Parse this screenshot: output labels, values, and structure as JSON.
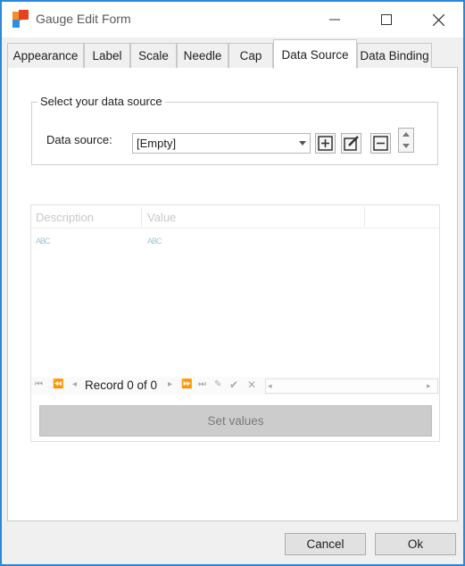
{
  "window": {
    "title": "Gauge Edit Form"
  },
  "colors": {
    "accent_border": "#2b88d8",
    "icon_red": "#e3431f",
    "icon_orange": "#f78d2c",
    "icon_blue": "#2d8fe0"
  },
  "tabs": [
    {
      "label": "Appearance",
      "active": false
    },
    {
      "label": "Label",
      "active": false
    },
    {
      "label": "Scale",
      "active": false
    },
    {
      "label": "Needle",
      "active": false
    },
    {
      "label": "Cap",
      "active": false
    },
    {
      "label": "Data Source",
      "active": true
    },
    {
      "label": "Data Binding",
      "active": false
    }
  ],
  "data_source_group": {
    "legend": "Select your data source",
    "field_label": "Data source:",
    "selected_value": "[Empty]",
    "actions": [
      "add-icon",
      "edit-icon",
      "remove-icon"
    ]
  },
  "grid": {
    "columns": [
      "Description",
      "Value"
    ],
    "cell_icon_text": "ABC",
    "navigator": {
      "record_text": "Record 0 of 0"
    },
    "set_values_label": "Set values"
  },
  "footer": {
    "cancel_label": "Cancel",
    "ok_label": "Ok"
  }
}
